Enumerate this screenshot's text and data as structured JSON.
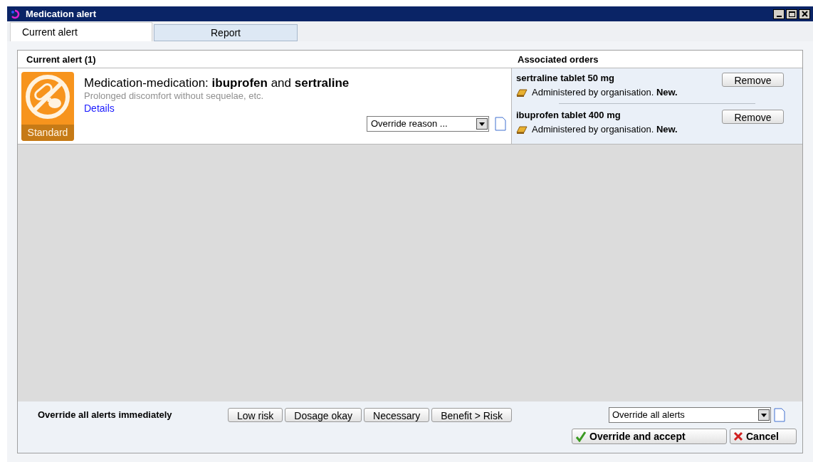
{
  "window": {
    "title": "Medication alert"
  },
  "tabs": [
    {
      "label": "Current alert",
      "selected": true
    },
    {
      "label": "Report",
      "selected": false
    }
  ],
  "current_alert": {
    "heading": "Current alert (1)",
    "severity": "Standard",
    "title": "Medication-medication: **ibuprofen** and **sertraline**",
    "description": "Prolonged discomfort without sequelae, etc.",
    "link": "Details",
    "override_reason": {
      "value": "Override reason ..."
    }
  },
  "associated_orders": {
    "heading": "Associated orders",
    "orders": [
      {
        "name": "sertraline tablet 50 mg",
        "status": "Administered by organisation. **New.**",
        "button": "Remove"
      },
      {
        "name": "ibuprofen tablet 400 mg",
        "status": "Administered by organisation. **New.**",
        "button": "Remove"
      }
    ]
  },
  "footer": {
    "label": "Override all alerts immediately",
    "quick_reasons": [
      "Low risk",
      "Dosage okay",
      "Necessary",
      "Benefit > Risk"
    ],
    "override_all": {
      "value": "Override all alerts"
    },
    "buttons": [
      {
        "kind": "accept",
        "label": "Override and accept"
      },
      {
        "kind": "cancel",
        "label": "Cancel"
      }
    ]
  }
}
